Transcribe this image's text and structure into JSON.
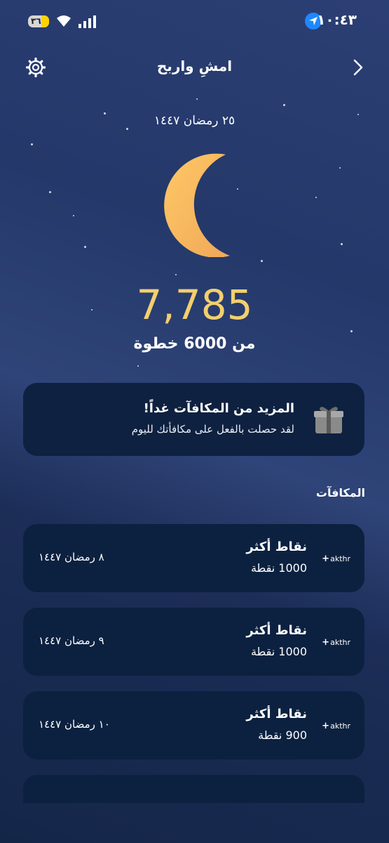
{
  "status_bar": {
    "time": "١٠:٤٣",
    "battery": "٣٦"
  },
  "header": {
    "title": "امشِ واربح"
  },
  "hijri_date": "٢٥ رمضان ١٤٤٧",
  "steps": {
    "count": "7,785",
    "goal_text": "من 6000 خطوة"
  },
  "banner": {
    "title": "المزيد من المكافآت غداً!",
    "subtitle": "لقد حصلت بالفعل على مكافأتك لليوم"
  },
  "rewards": {
    "heading": "المكافآت",
    "items": [
      {
        "brand": "akthr",
        "name": "نقاط أكثر",
        "points": "1000 نقطة",
        "date": "٨ رمضان ١٤٤٧"
      },
      {
        "brand": "akthr",
        "name": "نقاط أكثر",
        "points": "1000 نقطة",
        "date": "٩ رمضان ١٤٤٧"
      },
      {
        "brand": "akthr",
        "name": "نقاط أكثر",
        "points": "900 نقطة",
        "date": "١٠ رمضان ١٤٤٧"
      }
    ]
  }
}
